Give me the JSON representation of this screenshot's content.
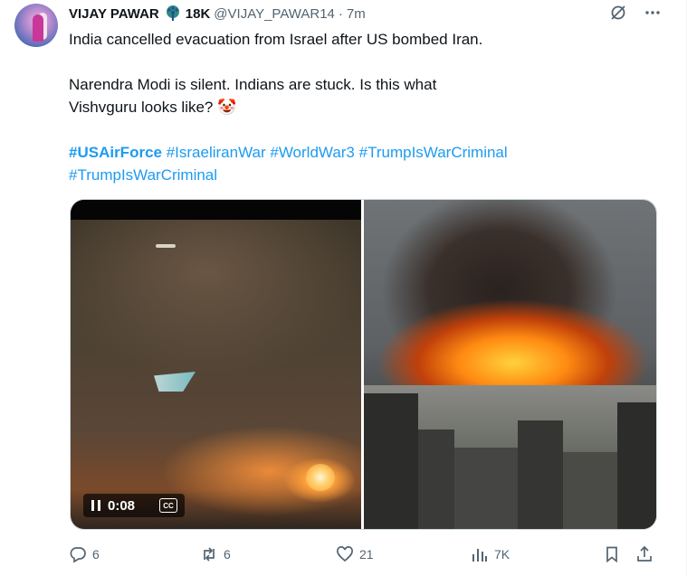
{
  "author": {
    "name": "VIJAY PAWAR",
    "followers": "18K",
    "handle": "@VIJAY_PAWAR14",
    "separator": "·",
    "time": "7m"
  },
  "post": {
    "line1": "India cancelled evacuation from Israel after US bombed Iran.",
    "line2": "Narendra Modi is silent. Indians are stuck. Is this what",
    "line3": "Vishvguru looks like? 🤡",
    "hashtags": [
      "#USAirForce",
      "#IsraeliranWar",
      "#WorldWar3",
      "#TrumpIsWarCriminal",
      "#TrumpIsWarCriminal"
    ]
  },
  "media": {
    "video_duration": "0:08",
    "cc_label": "CC"
  },
  "actions": {
    "replies": "6",
    "reposts": "6",
    "likes": "21",
    "views": "7K"
  },
  "icons": [
    "peacock-emoji",
    "grok-icon",
    "more-icon",
    "pause-icon",
    "cc-icon",
    "reply-icon",
    "repost-icon",
    "like-icon",
    "views-icon",
    "bookmark-icon",
    "share-icon"
  ],
  "colors": {
    "link": "#1d9bf0",
    "muted": "#536471",
    "text": "#0f1419"
  }
}
